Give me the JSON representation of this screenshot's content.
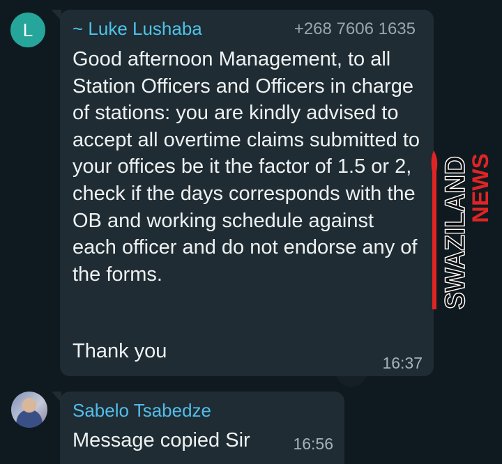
{
  "messages": [
    {
      "avatar_letter": "L",
      "sender": "~ Luke Lushaba",
      "phone": "+268 7606 1635",
      "body": "Good afternoon Management, to all Station Officers and Officers in charge of stations: you are kindly advised to accept all overtime claims submitted to your offices be it the factor of 1.5 or 2, check if the days corresponds with the OB and working schedule against each officer and do not endorse any of the forms.",
      "closing": "Thank you",
      "time": "16:37"
    },
    {
      "sender": "Sabelo Tsabedze",
      "body": "Message copied Sir",
      "time": "16:56"
    }
  ],
  "watermark": {
    "word1": "SWAZILAND",
    "word2": "NEWS"
  },
  "colors": {
    "background": "#0b141a",
    "bubble": "#1f2c33",
    "sender_name": "#53bdeb",
    "avatar": "#26a69a",
    "watermark_red": "#e02424"
  }
}
